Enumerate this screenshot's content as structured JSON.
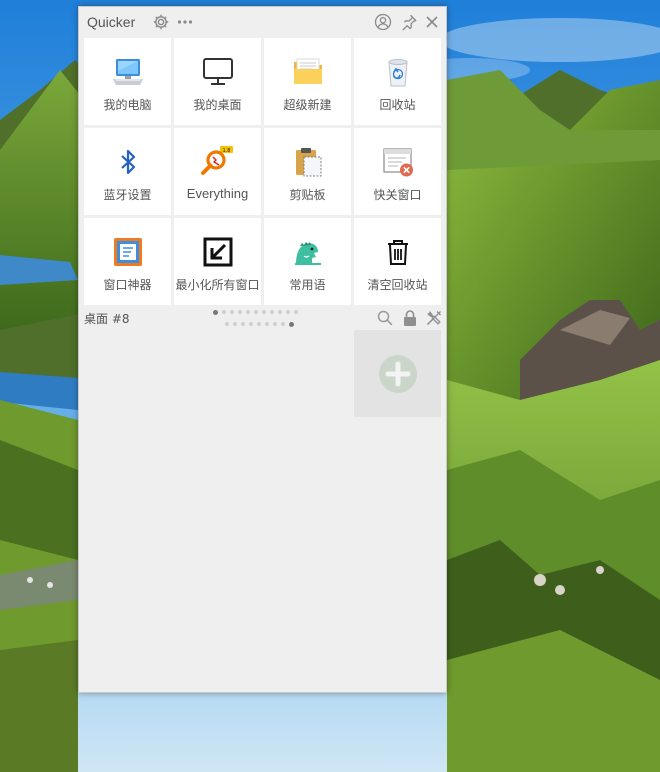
{
  "app": {
    "title": "Quicker"
  },
  "titlebar": {
    "icons": [
      "gear-icon",
      "more-icon",
      "account-icon",
      "pin-icon",
      "close-icon"
    ]
  },
  "tiles": [
    {
      "label": "我的电脑",
      "icon": "computer-icon"
    },
    {
      "label": "我的桌面",
      "icon": "monitor-icon"
    },
    {
      "label": "超级新建",
      "icon": "folder-icon"
    },
    {
      "label": "回收站",
      "icon": "recycle-bin-icon"
    },
    {
      "label": "蓝牙设置",
      "icon": "bluetooth-icon"
    },
    {
      "label": "Everything",
      "icon": "everything-search-icon"
    },
    {
      "label": "剪贴板",
      "icon": "clipboard-icon"
    },
    {
      "label": "快关窗口",
      "icon": "close-window-icon"
    },
    {
      "label": "窗口神器",
      "icon": "window-tool-icon"
    },
    {
      "label": "最小化所有窗口",
      "icon": "minimize-arrow-icon"
    },
    {
      "label": "常用语",
      "icon": "dinosaur-icon"
    },
    {
      "label": "清空回收站",
      "icon": "trash-icon"
    }
  ],
  "status": {
    "page_label": "桌面 #8",
    "pager": {
      "total": 20,
      "current": 20
    },
    "icons": [
      "search-icon",
      "lock-icon",
      "tools-icon"
    ]
  },
  "add_button": {
    "icon": "add-circle-icon"
  },
  "colors": {
    "panel_bg": "#efefef",
    "tile_bg": "#ffffff",
    "label_text": "#555555"
  }
}
